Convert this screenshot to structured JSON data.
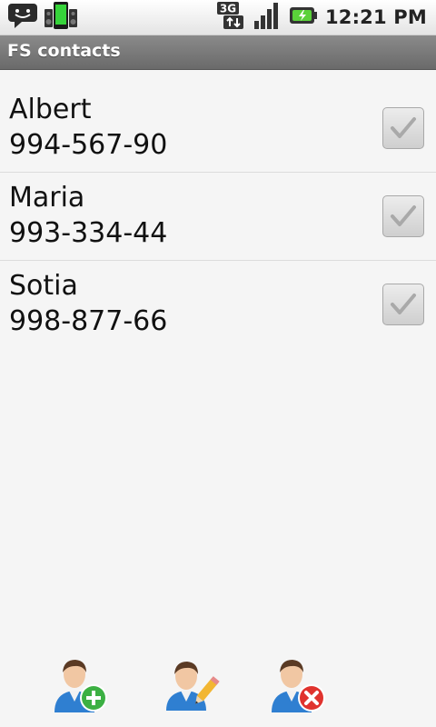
{
  "status_bar": {
    "time": "12:21 PM",
    "network_label": "3G",
    "icons": [
      "message-icon",
      "speaker-phone-icon",
      "3g-data-icon",
      "signal-icon",
      "battery-charging-icon"
    ]
  },
  "app": {
    "title": "FS contacts"
  },
  "contacts": [
    {
      "name": "Albert",
      "phone": "994-567-90",
      "checked": true
    },
    {
      "name": "Maria",
      "phone": "993-334-44",
      "checked": true
    },
    {
      "name": "Sotia",
      "phone": "998-877-66",
      "checked": true
    }
  ],
  "actions": {
    "add_icon": "add-contact-icon",
    "edit_icon": "edit-contact-icon",
    "delete_icon": "delete-contact-icon"
  },
  "colors": {
    "title_bar": "#7a7a7a",
    "background": "#f5f5f5",
    "add_green": "#3cb043",
    "delete_red": "#e0332e"
  }
}
